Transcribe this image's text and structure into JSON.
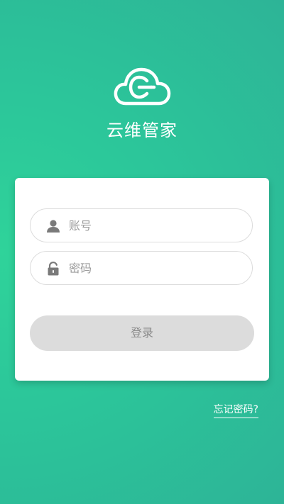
{
  "app": {
    "name": "云维管家",
    "logo_icon": "cloud-logo-icon"
  },
  "login": {
    "account_placeholder": "账号",
    "account_value": "",
    "account_icon": "user-icon",
    "password_placeholder": "密码",
    "password_value": "",
    "password_icon": "lock-icon",
    "submit_label": "登录",
    "forgot_label": "忘记密码?"
  },
  "colors": {
    "background": "#2cc79a",
    "button_disabled": "#dcdcdc",
    "button_text": "#8a8a8a",
    "placeholder": "#9a9a9a"
  }
}
